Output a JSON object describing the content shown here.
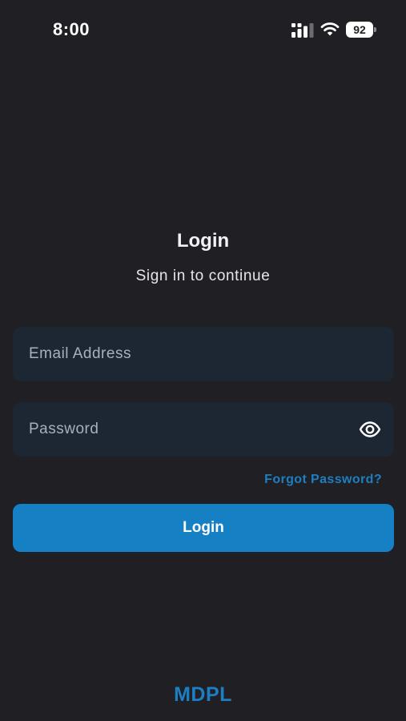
{
  "status_bar": {
    "time": "8:00",
    "battery_level": "92",
    "signal_icon": "cellular-signal-icon",
    "wifi_icon": "wifi-icon"
  },
  "header": {
    "title": "Login",
    "subtitle": "Sign in to continue"
  },
  "form": {
    "email_placeholder": "Email Address",
    "email_value": "",
    "password_placeholder": "Password",
    "password_value": "",
    "password_toggle_icon": "eye-icon",
    "forgot_password_label": "Forgot Password?",
    "login_button_label": "Login"
  },
  "footer": {
    "brand": "MDPL"
  },
  "colors": {
    "background": "#1f1f24",
    "field_background": "#1d2633",
    "accent": "#1580c3",
    "link": "#1e7fc0",
    "placeholder": "#a9b0ba"
  }
}
